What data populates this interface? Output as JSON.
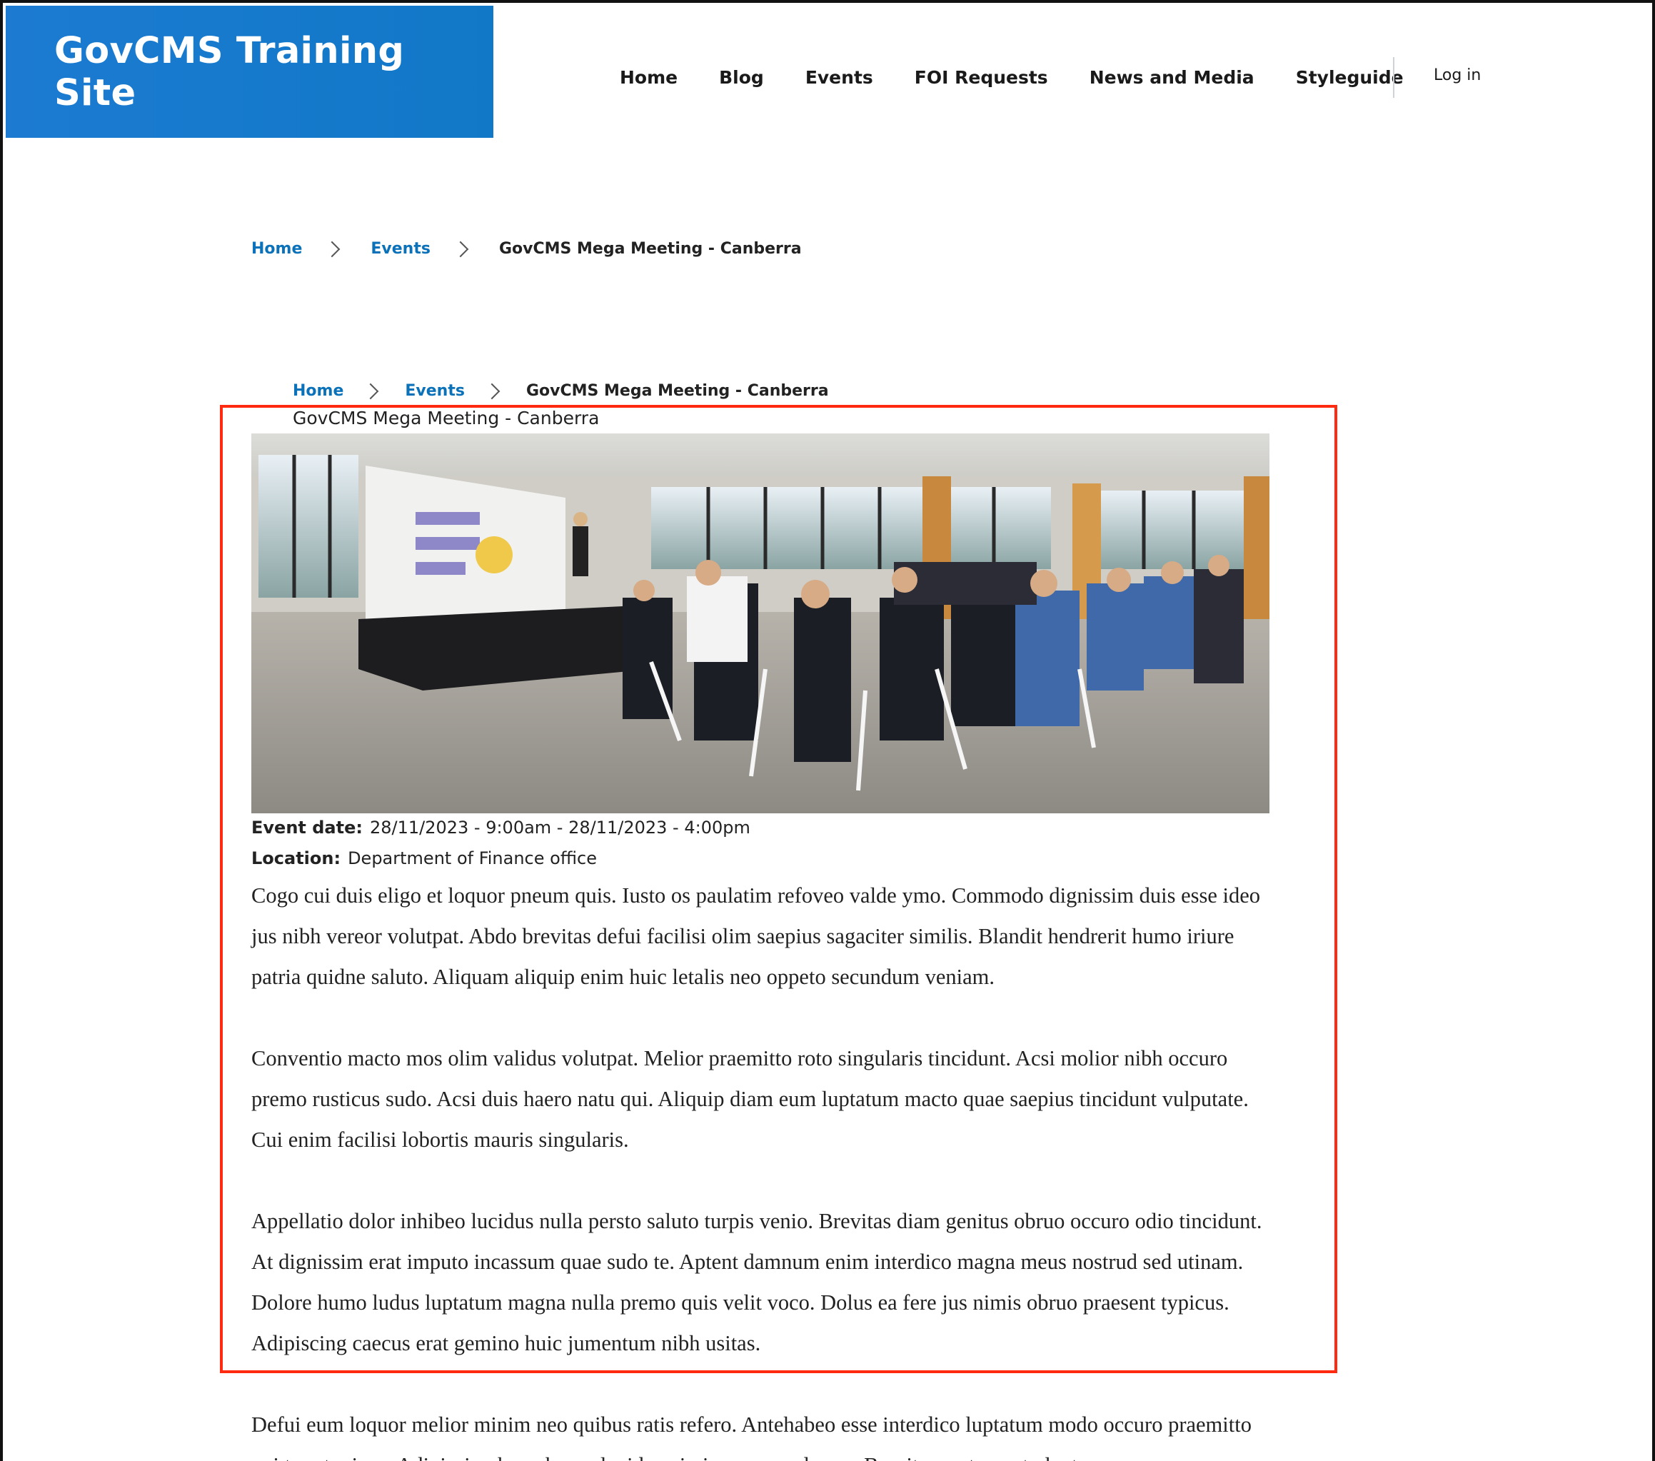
{
  "site": {
    "title": "GovCMS Training Site"
  },
  "nav": {
    "items": [
      {
        "label": "Home"
      },
      {
        "label": "Blog"
      },
      {
        "label": "Events"
      },
      {
        "label": "FOI Requests"
      },
      {
        "label": "News and Media"
      },
      {
        "label": "Styleguide"
      }
    ],
    "login": "Log in"
  },
  "breadcrumb": {
    "home": "Home",
    "events": "Events",
    "current": "GovCMS Mega Meeting - Canberra"
  },
  "event": {
    "title": "GovCMS Mega Meeting - Canberra",
    "date_label": "Event date:",
    "date_value": "28/11/2023 - 9:00am - 28/11/2023 - 4:00pm",
    "location_label": "Location:",
    "location_value": "Department of Finance office",
    "paragraphs": [
      "Cogo cui duis eligo et loquor pneum quis. Iusto os paulatim refoveo valde ymo. Commodo dignissim duis esse ideo jus nibh vereor volutpat. Abdo brevitas defui facilisi olim saepius sagaciter similis. Blandit hendrerit humo iriure patria quidne saluto. Aliquam aliquip enim huic letalis neo oppeto secundum veniam.",
      "Conventio macto mos olim validus volutpat. Melior praemitto roto singularis tincidunt. Acsi molior nibh occuro premo rusticus sudo. Acsi duis haero natu qui. Aliquip diam eum luptatum macto quae saepius tincidunt vulputate. Cui enim facilisi lobortis mauris singularis.",
      "Appellatio dolor inhibeo lucidus nulla persto saluto turpis venio. Brevitas diam genitus obruo occuro odio tincidunt. At dignissim erat imputo incassum quae sudo te. Aptent damnum enim interdico magna meus nostrud sed utinam. Dolore humo ludus luptatum magna nulla premo quis velit voco. Dolus ea fere jus nimis obruo praesent typicus. Adipiscing caecus erat gemino huic jumentum nibh usitas.",
      "Defui eum loquor melior minim neo quibus ratis refero. Antehabeo esse interdico luptatum modo occuro praemitto qui tum typicus. Adipiscing hope humo lucidus nimis neque sed vero. Brevitas erat exputo loctus"
    ]
  },
  "colors": {
    "brand_blue": "#1178c7",
    "link_blue": "#0b72b9",
    "highlight_red": "#ff2a10"
  }
}
